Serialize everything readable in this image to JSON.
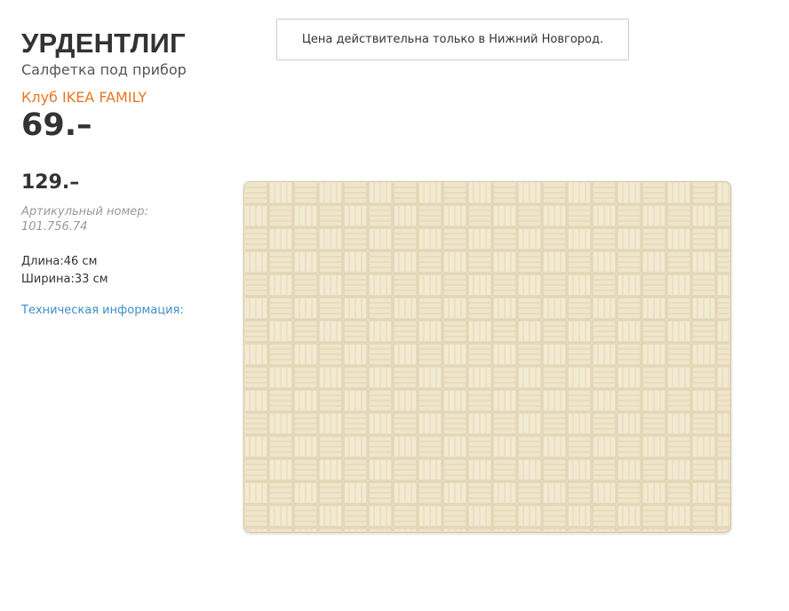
{
  "product": {
    "name": "УРДЕНТЛИГ",
    "type": "Салфетка под прибор",
    "family_label": "Клуб IKEA FAMILY",
    "family_price": "69.–",
    "regular_price": "129.–",
    "article_label": "Артикульный номер: 101.756.74",
    "length": "Длина:46 см",
    "width": "Ширина:33 см",
    "tech_info_link": "Техническая информация:"
  },
  "notice": {
    "text": "Цена действительна только в Нижний Новгород."
  },
  "colors": {
    "family_orange": "#e87722",
    "link_blue": "#3f8ec9",
    "mat_beige": "#ede2c7"
  },
  "image": {
    "subject": "woven-placemat-image"
  }
}
